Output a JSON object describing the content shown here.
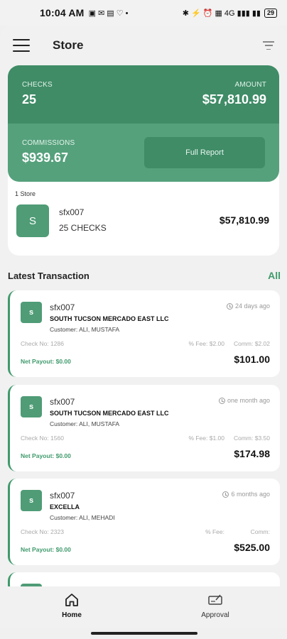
{
  "status_bar": {
    "time": "10:04 AM",
    "left_icons": "▣ ✉ ▤ ♡ •",
    "right_icons": "✱ ⚡ ⏰ ▦ 4G ▮▮▮ ▮▮",
    "battery": "29"
  },
  "header": {
    "title": "Store"
  },
  "summary": {
    "checks_label": "CHECKS",
    "checks_value": "25",
    "amount_label": "AMOUNT",
    "amount_value": "$57,810.99",
    "commissions_label": "COMMISSIONS",
    "commissions_value": "$939.67",
    "full_report_label": "Full Report"
  },
  "store_list": {
    "count_label": "1 Store",
    "items": [
      {
        "initial": "S",
        "name": "sfx007",
        "checks": "25 CHECKS",
        "amount": "$57,810.99"
      }
    ]
  },
  "latest": {
    "title": "Latest Transaction",
    "all_label": "All",
    "transactions": [
      {
        "initial": "s",
        "store": "sfx007",
        "merchant": "SOUTH TUCSON MERCADO EAST LLC",
        "customer": "Customer: ALI, MUSTAFA",
        "time": "24 days ago",
        "check_no": "Check No: 1286",
        "fee": "% Fee: $2.00",
        "comm": "Comm: $2.02",
        "payout": "Net Payout: $0.00",
        "amount": "$101.00"
      },
      {
        "initial": "s",
        "store": "sfx007",
        "merchant": "SOUTH TUCSON MERCADO EAST LLC",
        "customer": "Customer: ALI, MUSTAFA",
        "time": "one month ago",
        "check_no": "Check No: 1560",
        "fee": "% Fee: $1.00",
        "comm": "Comm: $3.50",
        "payout": "Net Payout: $0.00",
        "amount": "$174.98"
      },
      {
        "initial": "s",
        "store": "sfx007",
        "merchant": "EXCELLA",
        "customer": "Customer: ALI, MEHADI",
        "time": "6 months ago",
        "check_no": "Check No: 2323",
        "fee": "% Fee:",
        "comm": "Comm:",
        "payout": "Net Payout: $0.00",
        "amount": "$525.00"
      }
    ]
  },
  "bottom_nav": {
    "home_label": "Home",
    "approval_label": "Approval"
  },
  "colors": {
    "green_dark": "#3f8c67",
    "green_light": "#55a17c",
    "accent": "#3f9a6c"
  }
}
